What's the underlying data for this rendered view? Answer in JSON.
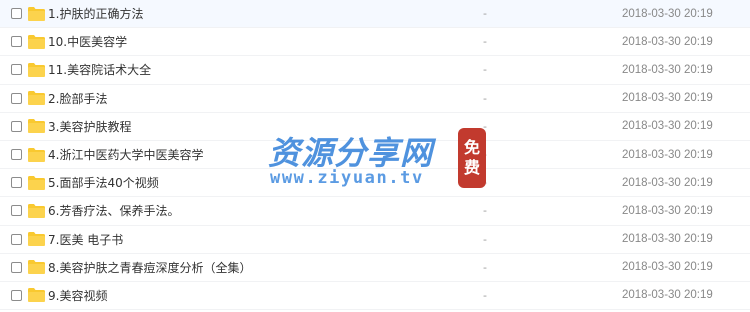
{
  "files": [
    {
      "name": "1.护肤的正确方法",
      "size": "-",
      "modified": "2018-03-30 20:19"
    },
    {
      "name": "10.中医美容学",
      "size": "-",
      "modified": "2018-03-30 20:19"
    },
    {
      "name": "11.美容院话术大全",
      "size": "-",
      "modified": "2018-03-30 20:19"
    },
    {
      "name": "2.脸部手法",
      "size": "-",
      "modified": "2018-03-30 20:19"
    },
    {
      "name": "3.美容护肤教程",
      "size": "-",
      "modified": "2018-03-30 20:19"
    },
    {
      "name": "4.浙江中医药大学中医美容学",
      "size": "-",
      "modified": "2018-03-30 20:19"
    },
    {
      "name": "5.面部手法40个视频",
      "size": "-",
      "modified": "2018-03-30 20:19"
    },
    {
      "name": "6.芳香疗法、保养手法。",
      "size": "-",
      "modified": "2018-03-30 20:19"
    },
    {
      "name": "7.医美 电子书",
      "size": "-",
      "modified": "2018-03-30 20:19"
    },
    {
      "name": "8.美容护肤之青春痘深度分析（全集）",
      "size": "-",
      "modified": "2018-03-30 20:19"
    },
    {
      "name": "9.美容视频",
      "size": "-",
      "modified": "2018-03-30 20:19"
    }
  ],
  "icon": "folder-icon",
  "colors": {
    "folder": "#f9c930",
    "watermark_blue": "#4f92de",
    "stamp_red": "#c23a2e"
  },
  "watermark": {
    "title": "资源分享网",
    "url": "www.ziyuan.tv",
    "stamp": [
      "免",
      "费"
    ]
  }
}
